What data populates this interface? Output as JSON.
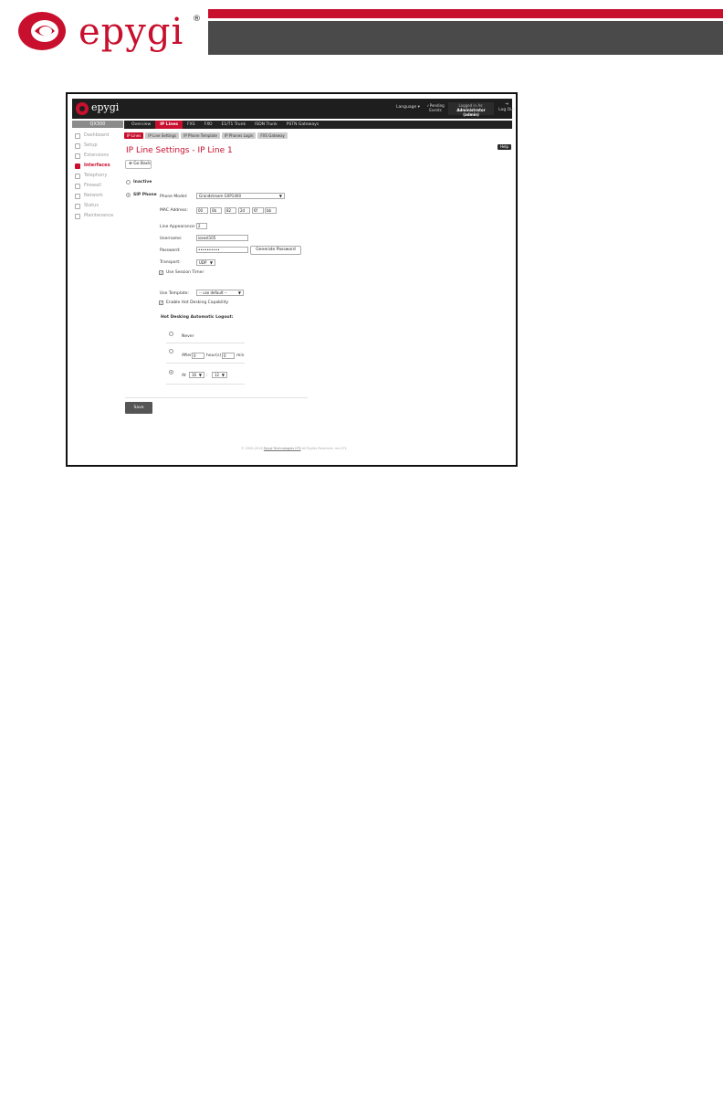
{
  "document": {
    "brand": "epygi",
    "reg_mark": "®"
  },
  "topbar": {
    "logo_text": "epygi",
    "language": "Language ▾",
    "pending": [
      "✓Pending",
      "Events"
    ],
    "logged_in_as": "Logged in As:",
    "user": "Administrator (admin)",
    "logout": "Log Out"
  },
  "sidebar": {
    "title": "QX300",
    "items": [
      {
        "label": "Dashboard",
        "icon": "dashboard-icon",
        "active": false
      },
      {
        "label": "Setup",
        "icon": "gear-icon",
        "active": false
      },
      {
        "label": "Extensions",
        "icon": "extensions-icon",
        "active": false
      },
      {
        "label": "Interfaces",
        "icon": "interfaces-icon",
        "active": true
      },
      {
        "label": "Telephony",
        "icon": "phone-icon",
        "active": false
      },
      {
        "label": "Firewall",
        "icon": "firewall-icon",
        "active": false
      },
      {
        "label": "Network",
        "icon": "network-icon",
        "active": false
      },
      {
        "label": "Status",
        "icon": "status-icon",
        "active": false
      },
      {
        "label": "Maintenance",
        "icon": "wrench-icon",
        "active": false
      }
    ]
  },
  "mainnav": {
    "tabs": [
      {
        "label": "Overview",
        "active": false
      },
      {
        "label": "IP Lines",
        "active": true
      },
      {
        "label": "FXS",
        "active": false
      },
      {
        "label": "FXO",
        "active": false
      },
      {
        "label": "E1/T1 Trunk",
        "active": false
      },
      {
        "label": "ISDN Trunk",
        "active": false
      },
      {
        "label": "PSTN Gateways",
        "active": false
      }
    ]
  },
  "subnav": {
    "tabs": [
      {
        "label": "IP Lines",
        "active": true
      },
      {
        "label": "IP Line Settings",
        "active": false
      },
      {
        "label": "IP Phone Template",
        "active": false
      },
      {
        "label": "IP Phones Login",
        "active": false
      },
      {
        "label": "FXS Gateway",
        "active": false
      }
    ]
  },
  "help": "Help",
  "page_title": "IP Line Settings - IP Line 1",
  "go_back": "Go Back",
  "form": {
    "inactive_label": "Inactive",
    "sip_phone_label": "SIP Phone",
    "phone_model_label": "Phone Model:",
    "phone_model_value": "Grandstream GXP1400",
    "mac_label": "MAC Address:",
    "mac": [
      "00",
      "0b",
      "82",
      "2d",
      "6f",
      "bb"
    ],
    "line_appearance_label": "Line Appearance:",
    "line_appearance_value": "2",
    "username_label": "Username:",
    "username_value": "iosest105",
    "password_label": "Password:",
    "password_value": "••••••••••",
    "generate_password": "Generate Password",
    "transport_label": "Transport:",
    "transport_value": "UDP",
    "session_timer": "Use Session Timer",
    "use_template_label": "Use Template:",
    "use_template_value": "-- use default --",
    "hot_desking_capability": "Enable Hot Desking Capability",
    "hot_desking_title": "Hot Desking Automatic Logout:",
    "never": "Never",
    "after": "After",
    "after_hours": "0",
    "hours_label": "hour(s)",
    "after_min": "0",
    "min_label": "min",
    "at": "At",
    "at_hour": "16",
    "at_min": "12",
    "colon": ":"
  },
  "save": "Save",
  "footer": {
    "prefix": "© 2009-2016",
    "link": "Epygi Technologies LTD",
    "suffix": "All Rights Reserved. rev.371"
  }
}
